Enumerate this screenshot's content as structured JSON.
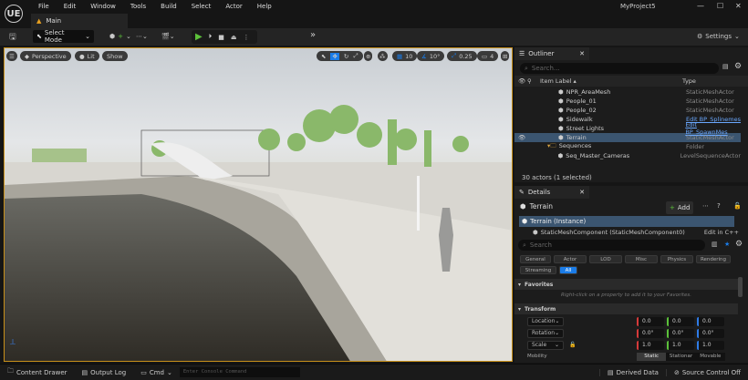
{
  "app": {
    "title": "MyProject5",
    "logo": "UE"
  },
  "menu": [
    "File",
    "Edit",
    "Window",
    "Tools",
    "Build",
    "Select",
    "Actor",
    "Help"
  ],
  "tab": {
    "label": "Main"
  },
  "toolbar": {
    "mode": "Select Mode",
    "settings": "Settings"
  },
  "viewport": {
    "menu_icon": "hamburger-icon",
    "perspective": "Perspective",
    "lit": "Lit",
    "show": "Show",
    "grid_snap": "10",
    "angle_snap": "10°",
    "scale_snap": "0.25",
    "camera_speed": "4"
  },
  "outliner": {
    "title": "Outliner",
    "search_placeholder": "Search...",
    "col_label": "Item Label ▴",
    "col_type": "Type",
    "rows": [
      {
        "label": "NPR_AreaMesh",
        "type": "StaticMeshActor"
      },
      {
        "label": "People_01",
        "type": "StaticMeshActor"
      },
      {
        "label": "People_02",
        "type": "StaticMeshActor"
      },
      {
        "label": "Sidewalk",
        "type": "Edit BP_Splinemes",
        "link": true
      },
      {
        "label": "Street Lights",
        "type": "Edit BP_SpawnMes",
        "link": true
      },
      {
        "label": "Terrain",
        "type": "StaticMeshActor",
        "selected": true
      },
      {
        "label": "Sequences",
        "type": "Folder",
        "folder": true
      },
      {
        "label": "Seq_Master_Cameras",
        "type": "LevelSequenceActor"
      }
    ],
    "footer": "30 actors (1 selected)"
  },
  "details": {
    "title": "Details",
    "actor": "Terrain",
    "add": "Add",
    "instance": "Terrain (Instance)",
    "component": "StaticMeshComponent (StaticMeshComponent0)",
    "edit_cpp": "Edit in C++",
    "search_placeholder": "Search",
    "filters": [
      "General",
      "Actor",
      "LOD",
      "Misc",
      "Physics",
      "Rendering",
      "Streaming",
      "All"
    ],
    "favorites": "Favorites",
    "favorites_hint": "Right-click on a property to add it to your Favorites.",
    "transform": "Transform",
    "props": [
      {
        "name": "Location",
        "values": [
          "0.0",
          "0.0",
          "0.0"
        ]
      },
      {
        "name": "Rotation",
        "values": [
          "0.0°",
          "0.0°",
          "0.0°"
        ]
      },
      {
        "name": "Scale",
        "values": [
          "1.0",
          "1.0",
          "1.0"
        ]
      }
    ],
    "mobility": "Mobility",
    "mobility_options": [
      "Static",
      "Stationar",
      "Movable"
    ],
    "mobility_selected": "Static"
  },
  "status": {
    "content_drawer": "Content Drawer",
    "output_log": "Output Log",
    "cmd": "Cmd",
    "console_placeholder": "Enter Console Command",
    "derived_data": "Derived Data",
    "source_control": "Source Control Off"
  },
  "colors": {
    "accent": "#1a7ce8",
    "play": "#5cc13a",
    "selection": "#3b5570",
    "viewport_border": "#c8901a"
  }
}
